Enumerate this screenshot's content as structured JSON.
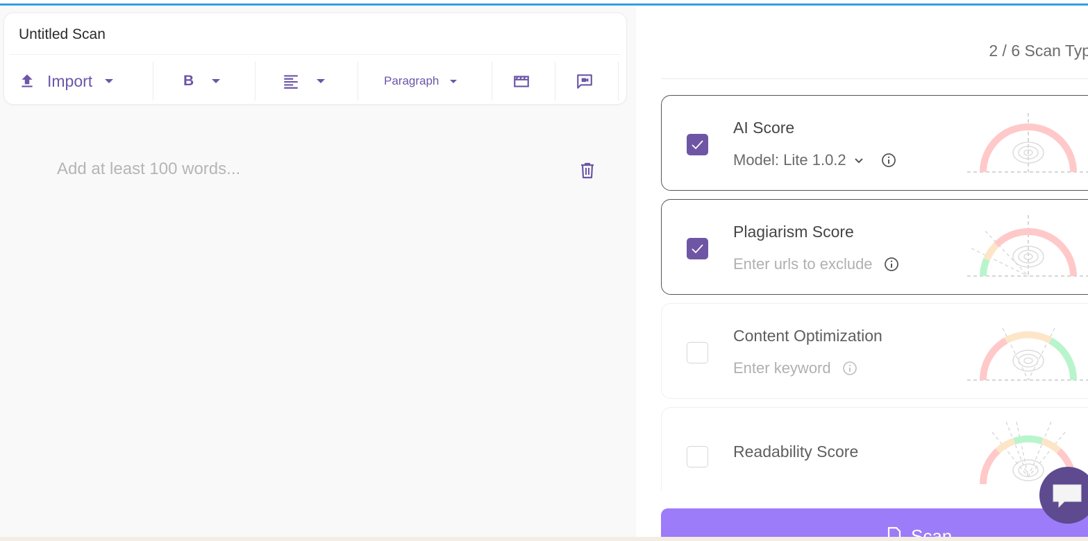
{
  "editor": {
    "title": "Untitled Scan",
    "placeholder": "Add at least 100 words...",
    "toolbar": {
      "import_label": "Import",
      "bold_label": "B",
      "paragraph_label": "Paragraph"
    }
  },
  "scan_panel": {
    "count_label": "2 / 6 Scan Typ",
    "cards": [
      {
        "title": "AI Score",
        "subtitle": "Model: Lite 1.0.2",
        "checked": true
      },
      {
        "title": "Plagiarism Score",
        "subtitle": "Enter urls to exclude",
        "checked": true
      },
      {
        "title": "Content Optimization",
        "subtitle": "Enter keyword",
        "checked": false
      },
      {
        "title": "Readability Score",
        "subtitle": "",
        "checked": false
      }
    ],
    "scan_button_label": "Scan"
  },
  "colors": {
    "accent": "#6e56a4",
    "scan_button": "#9c7cf9",
    "gauge_red": "#ffc9c9",
    "gauge_yellow": "#fde6c8",
    "gauge_green": "#b8f5cc",
    "top_bar": "#2f9fe6"
  },
  "icons": [
    "upload-icon",
    "bold-icon",
    "align-left-icon",
    "video-icon",
    "comment-icon",
    "trash-icon",
    "check-icon",
    "chevron-down-icon",
    "info-icon",
    "brain-icon",
    "document-icon",
    "chat-icon"
  ]
}
